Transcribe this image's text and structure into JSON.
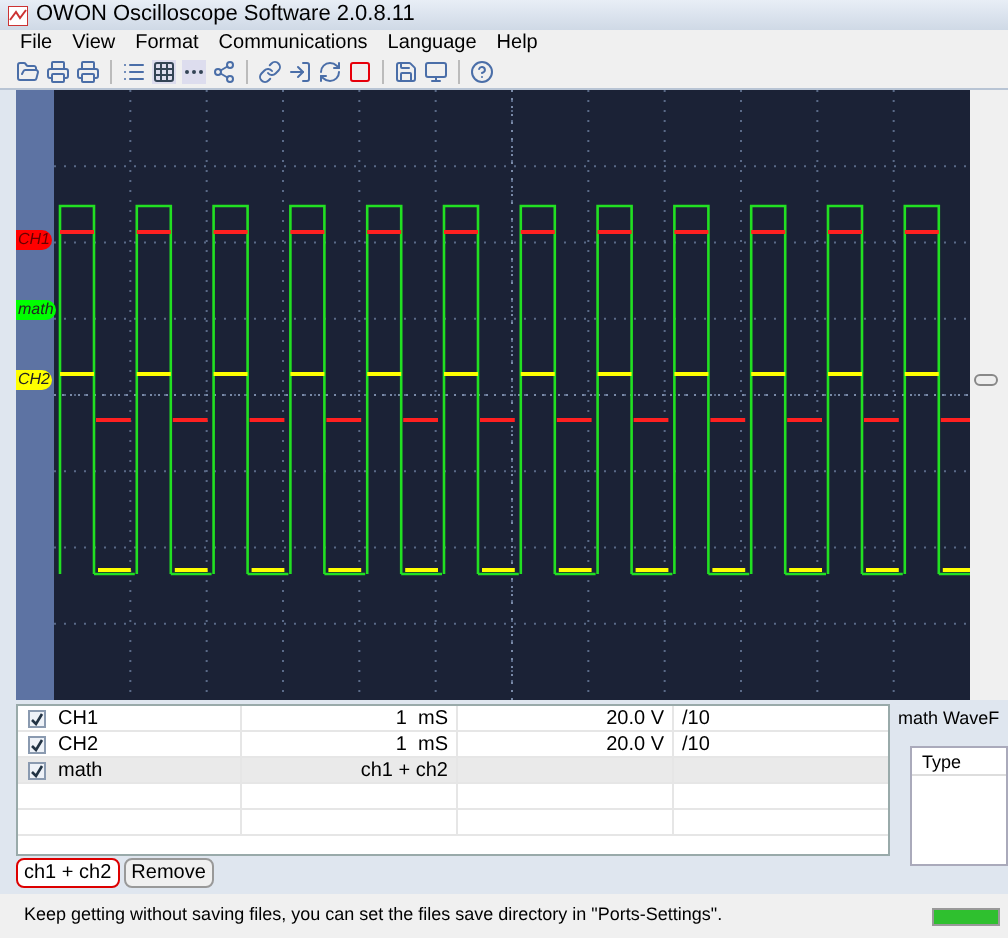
{
  "window": {
    "title": "OWON Oscilloscope Software 2.0.8.11"
  },
  "menu": [
    "File",
    "View",
    "Format",
    "Communications",
    "Language",
    "Help"
  ],
  "scope": {
    "markers": [
      {
        "label": "CH1",
        "color": "#ff0000"
      },
      {
        "label": "math",
        "color": "#00ff00"
      },
      {
        "label": "CH2",
        "color": "#ffff00"
      }
    ]
  },
  "channels": {
    "rows": [
      {
        "checked": true,
        "selected": false,
        "name": "CH1",
        "column_2": "1  mS",
        "column_3": "20.0 V",
        "column_4": "/10"
      },
      {
        "checked": true,
        "selected": false,
        "name": "CH2",
        "column_2": "1  mS",
        "column_3": "20.0 V",
        "column_4": "/10"
      },
      {
        "checked": true,
        "selected": true,
        "name": "math",
        "column_2": "ch1 + ch2",
        "column_3": "",
        "column_4": ""
      }
    ]
  },
  "math_panel": {
    "title": "math WaveF",
    "columns": [
      "Type"
    ]
  },
  "buttons": [
    {
      "label": "ch1 + ch2"
    },
    {
      "label": "Remove"
    }
  ],
  "status_bar": {
    "text": "Keep getting without saving files, you can set the files save directory in \"Ports-Settings\".",
    "level": 1
  }
}
